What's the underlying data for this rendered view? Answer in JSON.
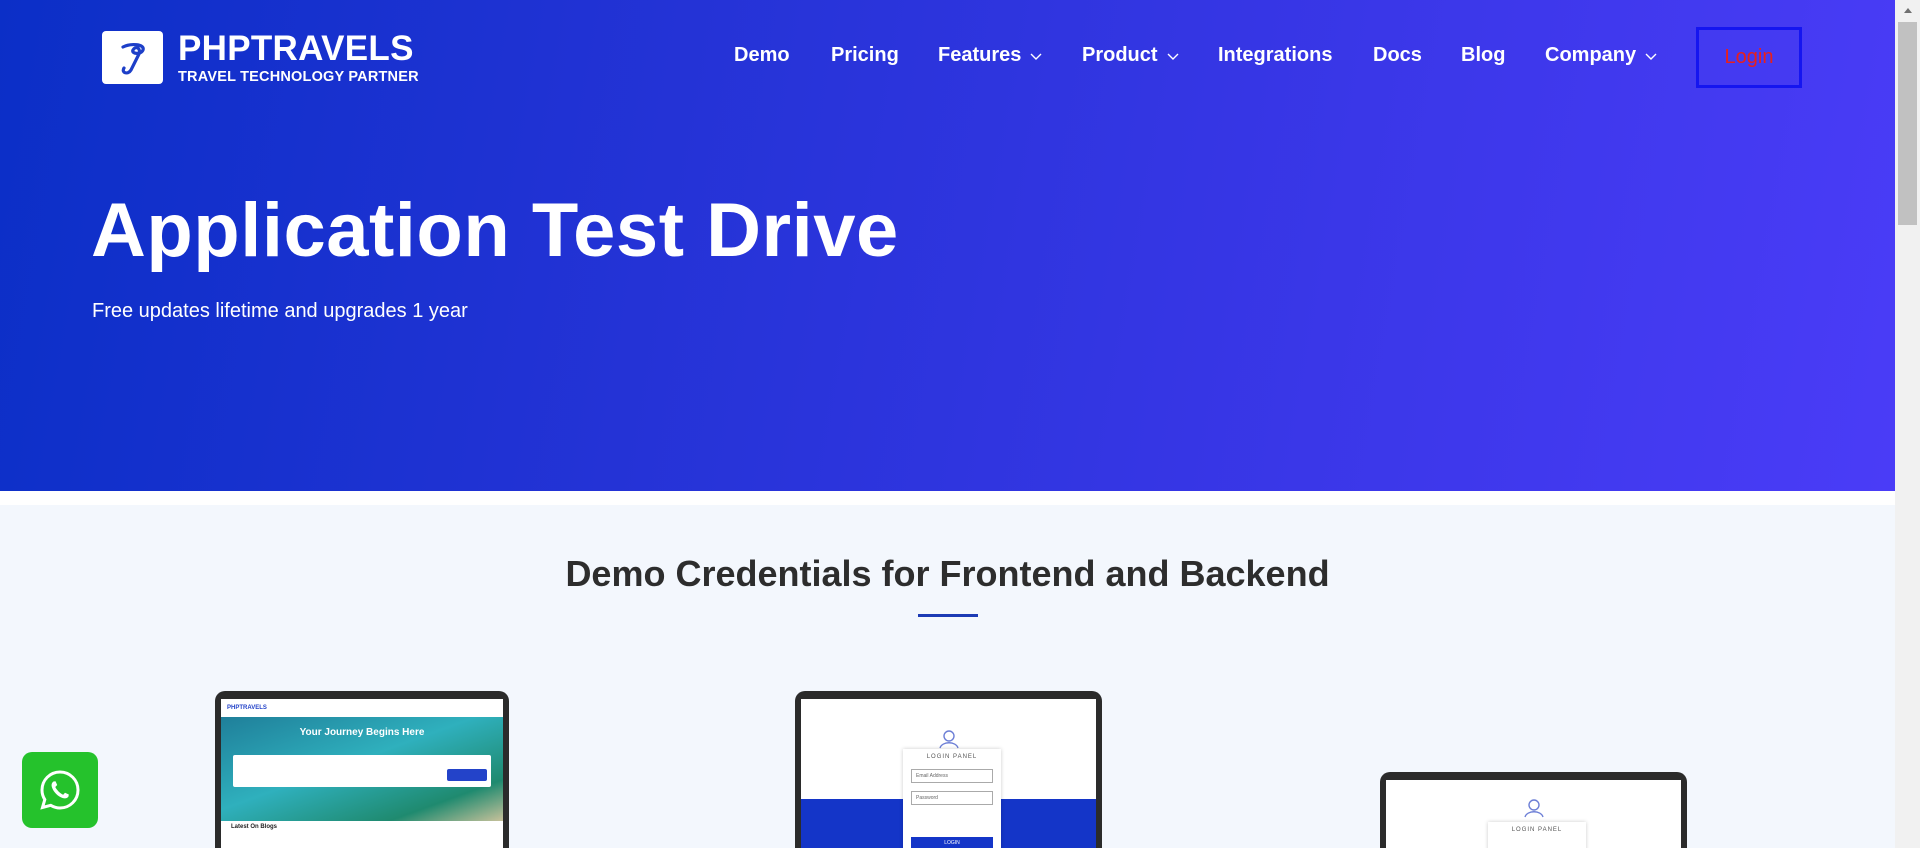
{
  "brand": {
    "name": "PHPTRAVELS",
    "tagline": "TRAVEL TECHNOLOGY PARTNER"
  },
  "nav": {
    "items": [
      {
        "label": "Demo",
        "has_dropdown": false
      },
      {
        "label": "Pricing",
        "has_dropdown": false
      },
      {
        "label": "Features",
        "has_dropdown": true
      },
      {
        "label": "Product",
        "has_dropdown": true
      },
      {
        "label": "Integrations",
        "has_dropdown": false
      },
      {
        "label": "Docs",
        "has_dropdown": false
      },
      {
        "label": "Blog",
        "has_dropdown": false
      },
      {
        "label": "Company",
        "has_dropdown": true
      }
    ],
    "login_label": "Login"
  },
  "hero": {
    "title": "Application Test Drive",
    "subtitle": "Free updates lifetime and upgrades 1 year"
  },
  "credentials": {
    "title": "Demo Credentials for Frontend and Backend"
  },
  "previews": {
    "frontend": {
      "brand": "PHPTRAVELS",
      "headline": "Your Journey Begins Here",
      "section": "Latest On Blogs"
    },
    "login_panel": {
      "label": "LOGIN PANEL",
      "email_placeholder": "Email Address",
      "password_placeholder": "Password",
      "button": "LOGIN"
    },
    "admin_panel": {
      "label": "LOGIN PANEL"
    }
  },
  "colors": {
    "hero_start": "#0b2fc7",
    "hero_end": "#4a3cf7",
    "login_border": "#1515f0",
    "login_text": "#e8201c",
    "whatsapp": "#25c22c",
    "accent": "#1c3bb5"
  },
  "icons": {
    "logo": "phptravels-logo-icon",
    "whatsapp": "whatsapp-icon",
    "dropdown": "chevron-down-icon"
  }
}
